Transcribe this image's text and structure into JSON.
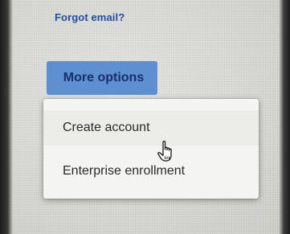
{
  "links": {
    "forgot_email": "Forgot email?"
  },
  "buttons": {
    "more_options": "More options"
  },
  "menu": {
    "items": [
      {
        "label": "Create account",
        "hovered": true
      },
      {
        "label": "Enterprise enrollment",
        "hovered": false
      }
    ]
  },
  "cursor": {
    "icon": "hand-pointer-icon"
  },
  "colors": {
    "link": "#1f4fa8",
    "button_bg": "#5e8fd0",
    "button_text": "#17306e",
    "menu_bg": "#f4f4f2"
  }
}
